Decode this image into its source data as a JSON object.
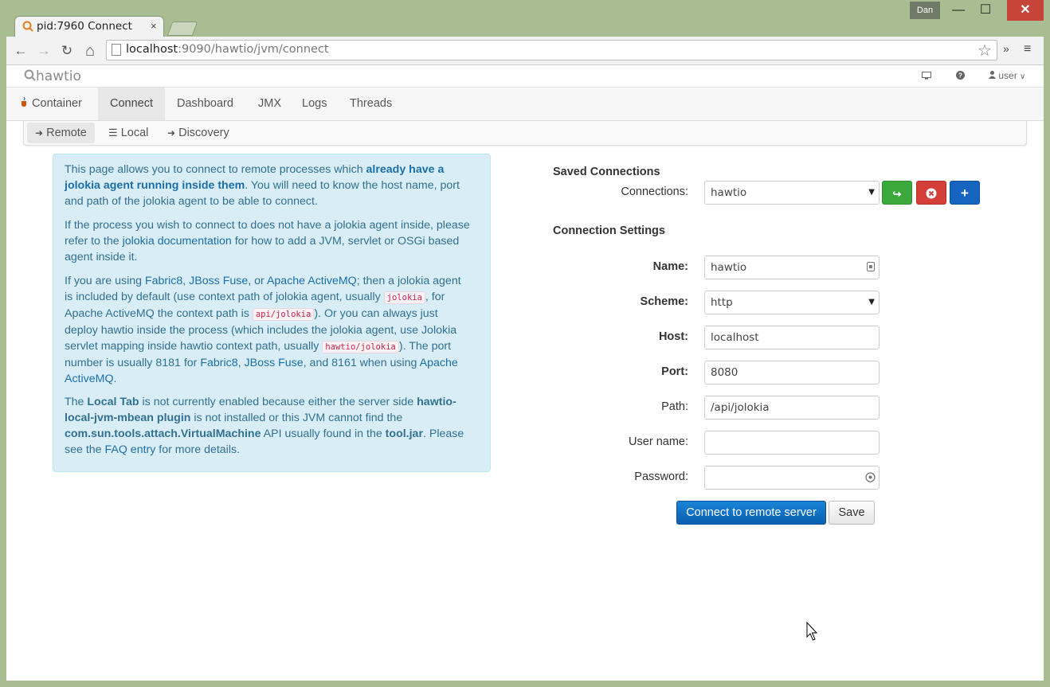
{
  "browser": {
    "tab_title": "pid:7960 Connect",
    "tab_close": "×",
    "profile": "Dan",
    "url_host": "localhost",
    "url_rest": ":9090/hawtio/jvm/connect",
    "min": "—",
    "max": "☐",
    "close": "✕",
    "back": "←",
    "forward": "→",
    "reload": "↻",
    "home": "⌂",
    "star": "☆",
    "extensions": "»",
    "menu": "≡"
  },
  "app": {
    "logo": "hawtio",
    "user": "user",
    "nav": [
      "Container",
      "Connect",
      "Dashboard",
      "JMX",
      "Logs",
      "Threads"
    ],
    "subnav": [
      "Remote",
      "Local",
      "Discovery"
    ]
  },
  "info": {
    "p1_a": "This page allows you to connect to remote processes which ",
    "p1_b": "already have a jolokia agent running inside them",
    "p1_c": ". You will need to know the host name, port and path of the jolokia agent to be able to connect.",
    "p2_a": "If the process you wish to connect to does not have a jolokia agent inside, please refer to the ",
    "p2_link": "jolokia documentation",
    "p2_b": " for how to add a JVM, servlet or OSGi based agent inside it.",
    "p3_a": "If you are using ",
    "p3_fabric": "Fabric8",
    "p3_sep1": ", ",
    "p3_jboss": "JBoss Fuse",
    "p3_sep2": ", or ",
    "p3_amq": "Apache ActiveMQ",
    "p3_b": "; then a jolokia agent is included by default (use context path of jolokia agent, usually ",
    "p3_code1": "jolokia",
    "p3_c": ", for Apache ActiveMQ the context path is ",
    "p3_code2": "api/jolokia",
    "p3_d": "). Or you can always just deploy hawtio inside the process (which includes the jolokia agent, use Jolokia servlet mapping inside hawtio context path, usually ",
    "p3_code3": "hawtio/jolokia",
    "p3_e": "). The port number is usually 8181 for ",
    "p3_fabric2": "Fabric8",
    "p3_sep3": ", ",
    "p3_jboss2": "JBoss Fuse",
    "p3_f": ", and 8161 when using ",
    "p3_amq2": "Apache ActiveMQ",
    "p3_g": ".",
    "p4_a": "The ",
    "p4_local": "Local Tab",
    "p4_b": " is not currently enabled because either the server side ",
    "p4_plugin": "hawtio-local-jvm-mbean plugin",
    "p4_c": " is not installed or this JVM cannot find the ",
    "p4_vm": "com.sun.tools.attach.VirtualMachine",
    "p4_d": " API usually found in the ",
    "p4_jar": "tool.jar",
    "p4_e": ". Please see the ",
    "p4_faq": "FAQ entry",
    "p4_f": " for more details."
  },
  "saved": {
    "heading": "Saved Connections",
    "label": "Connections:",
    "value": "hawtio"
  },
  "settings": {
    "heading": "Connection Settings",
    "name_label": "Name:",
    "name_value": "hawtio",
    "scheme_label": "Scheme:",
    "scheme_value": "http",
    "host_label": "Host:",
    "host_value": "localhost",
    "port_label": "Port:",
    "port_value": "8080",
    "path_label": "Path:",
    "path_value": "/api/jolokia",
    "user_label": "User name:",
    "user_value": "",
    "password_label": "Password:",
    "password_value": ""
  },
  "actions": {
    "connect": "Connect to remote server",
    "save": "Save"
  },
  "colors": {
    "share_btn": "#3aa83a",
    "delete_btn": "#d43f3a",
    "add_btn": "#1565c0"
  }
}
